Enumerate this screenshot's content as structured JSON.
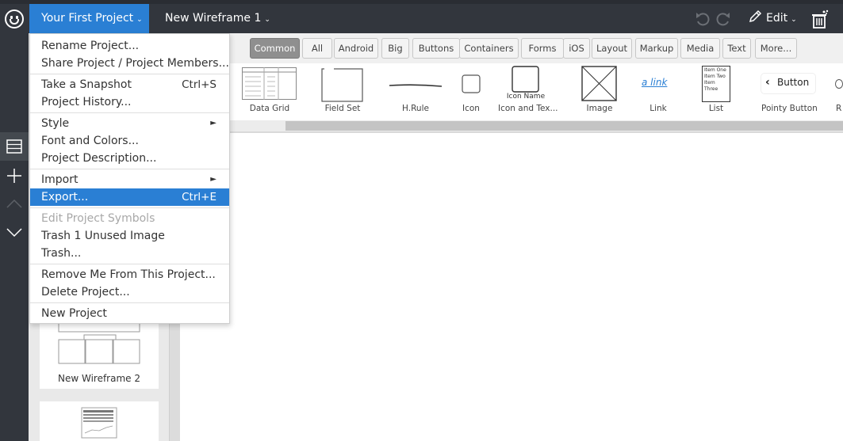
{
  "topbar": {
    "project_name": "Your First Project",
    "wireframe_name": "New Wireframe 1",
    "edit_label": "Edit",
    "logo_icon": "smiley-logo-icon",
    "accent_color": "#2a7fd4"
  },
  "library": {
    "tabs": [
      "Common",
      "All",
      "Android",
      "Big",
      "Buttons",
      "Containers",
      "Forms",
      "iOS",
      "Layout",
      "Markup",
      "Media",
      "Text",
      "More..."
    ],
    "active_tab": "Common",
    "items": [
      "Data Grid",
      "Field Set",
      "H.Rule",
      "Icon",
      "Icon and Tex...",
      "Image",
      "Link",
      "List",
      "Pointy Button"
    ],
    "item_samples": {
      "icon_name": "Icon Name",
      "link_text": "a link",
      "list_lines": [
        "Item One",
        "Item Two",
        "Item Three"
      ],
      "button_text": "Button",
      "cut_off_label": "R"
    }
  },
  "panel": {
    "thumbnails": [
      {
        "label": "New Wireframe 2"
      }
    ]
  },
  "menu": {
    "groups": [
      [
        {
          "label": "Rename Project..."
        },
        {
          "label": "Share Project / Project Members..."
        }
      ],
      [
        {
          "label": "Take a Snapshot",
          "shortcut": "Ctrl+S"
        },
        {
          "label": "Project History..."
        }
      ],
      [
        {
          "label": "Style",
          "submenu": true
        },
        {
          "label": "Font and Colors..."
        },
        {
          "label": "Project Description..."
        }
      ],
      [
        {
          "label": "Import",
          "submenu": true
        },
        {
          "label": "Export...",
          "shortcut": "Ctrl+E",
          "highlighted": true
        }
      ],
      [
        {
          "label": "Edit Project Symbols",
          "disabled": true
        },
        {
          "label": "Trash 1 Unused Image"
        },
        {
          "label": "Trash..."
        }
      ],
      [
        {
          "label": "Remove Me From This Project..."
        },
        {
          "label": "Delete Project..."
        }
      ],
      [
        {
          "label": "New Project"
        }
      ]
    ]
  }
}
